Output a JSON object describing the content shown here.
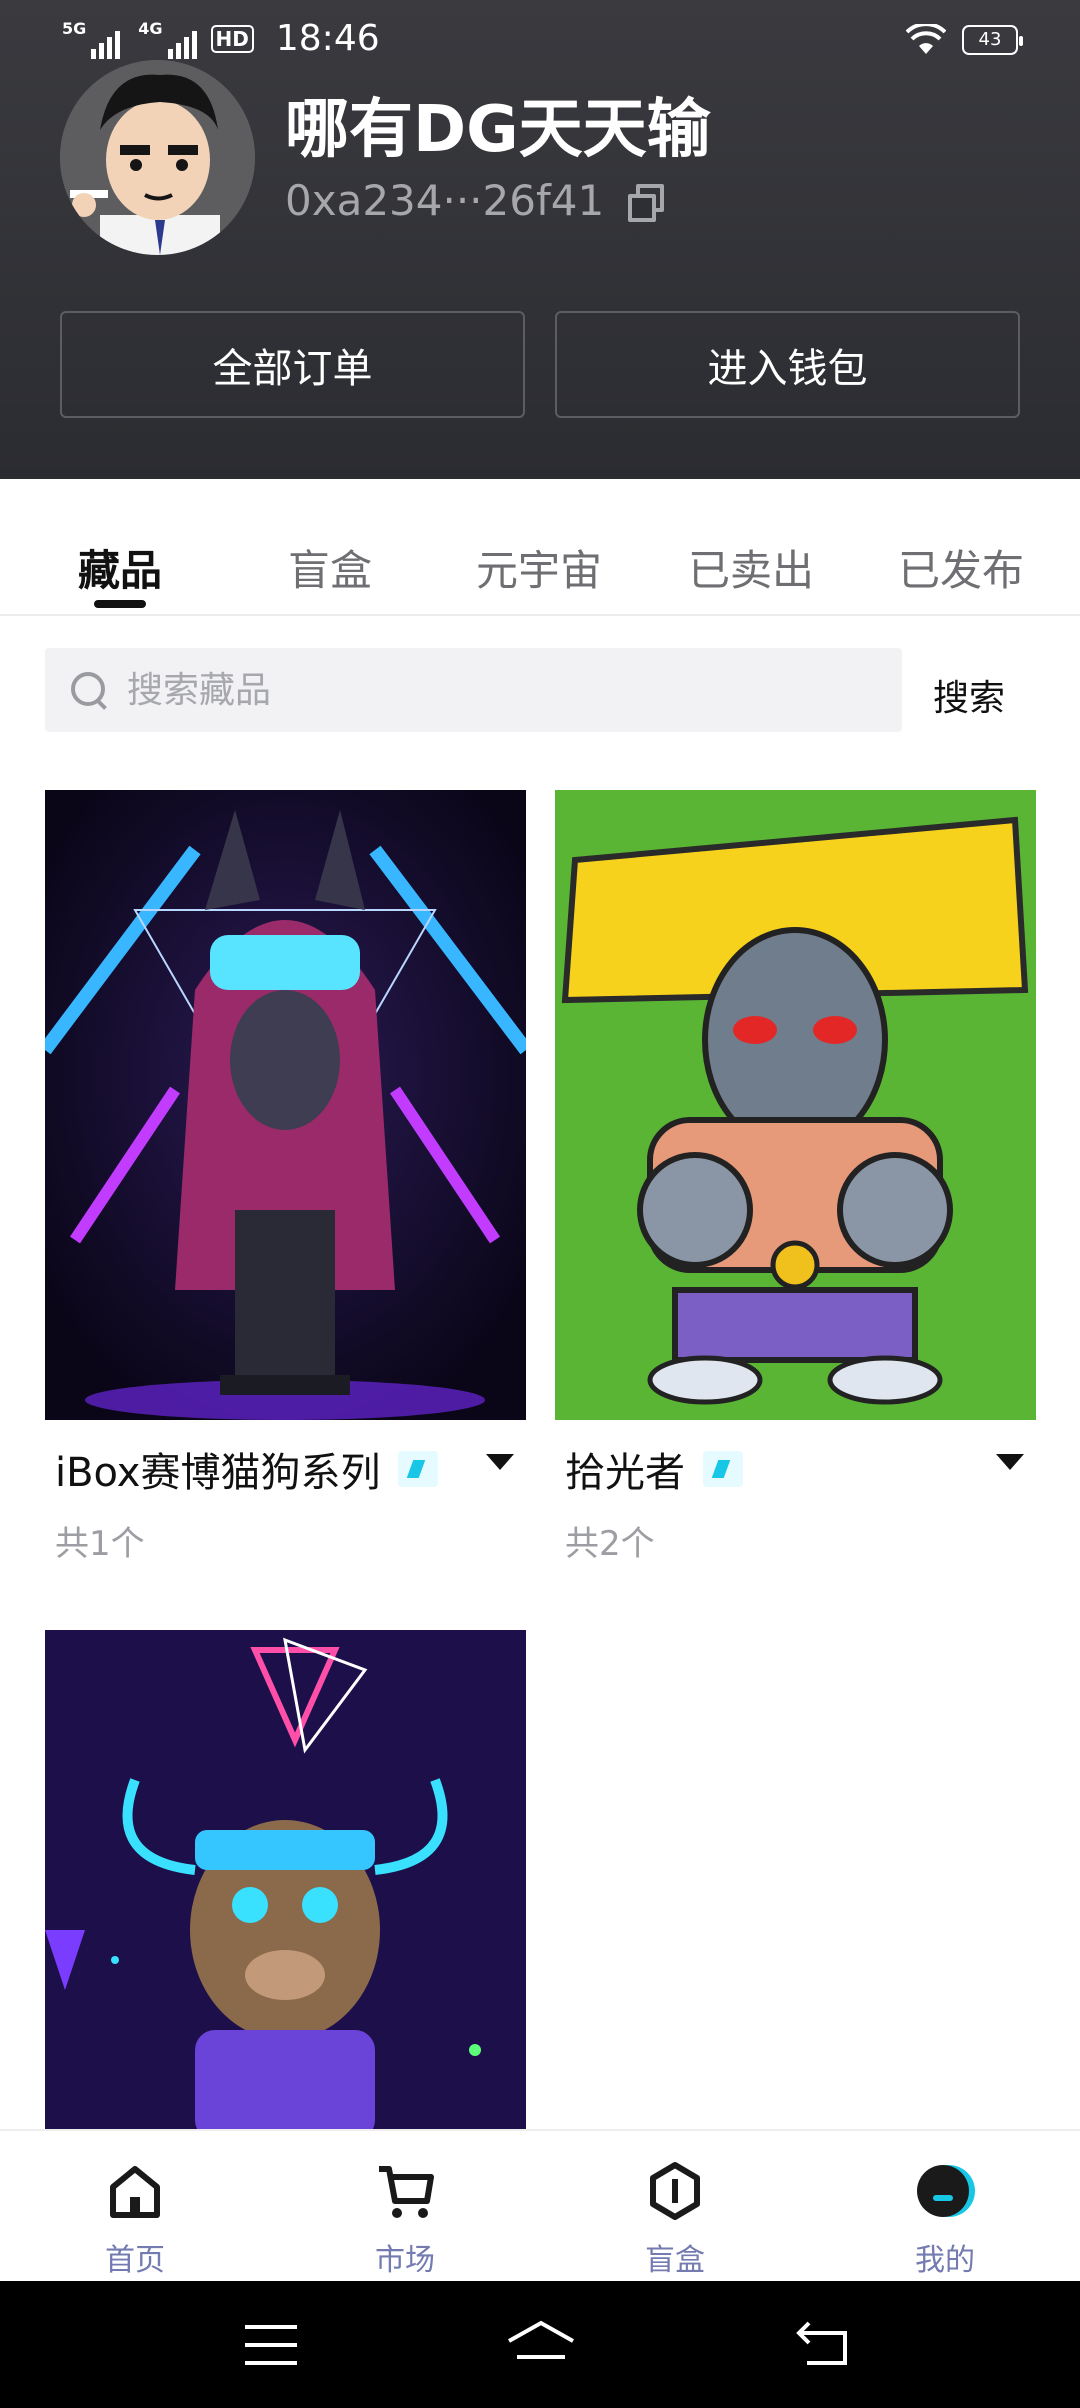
{
  "status_bar": {
    "net1": "5G",
    "net2": "4G",
    "hd": "HD",
    "time": "18:46",
    "battery": "43"
  },
  "profile": {
    "username": "哪有DG天天输",
    "address": "0xa234···26f41"
  },
  "header_buttons": {
    "orders": "全部订单",
    "wallet": "进入钱包"
  },
  "tabs": [
    {
      "label": "藏品",
      "active": true
    },
    {
      "label": "盲盒",
      "active": false
    },
    {
      "label": "元宇宙",
      "active": false
    },
    {
      "label": "已卖出",
      "active": false
    },
    {
      "label": "已发布",
      "active": false
    }
  ],
  "search": {
    "placeholder": "搜索藏品",
    "value": "",
    "button": "搜索"
  },
  "collections": [
    {
      "title": "iBox赛博猫狗系列",
      "count": "共1个"
    },
    {
      "title": "拾光者",
      "count": "共2个"
    },
    {
      "title": "",
      "count": ""
    }
  ],
  "bottom_nav": [
    {
      "label": "首页",
      "icon": "home-icon"
    },
    {
      "label": "市场",
      "icon": "cart-icon"
    },
    {
      "label": "盲盒",
      "icon": "blind-box-icon"
    },
    {
      "label": "我的",
      "icon": "profile-icon",
      "active": true
    }
  ],
  "colors": {
    "header_bg": "#2e2f34",
    "accent": "#18c7e6",
    "nav_label": "#737bb0"
  }
}
